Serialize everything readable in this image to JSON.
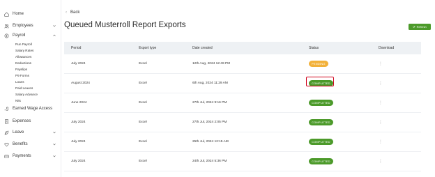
{
  "sidebar": {
    "items": [
      {
        "label": "Home",
        "icon": "home-icon"
      },
      {
        "label": "Employees",
        "icon": "users-icon"
      },
      {
        "label": "Payroll",
        "icon": "money-icon"
      },
      {
        "label": "Earned Wage Access",
        "icon": "hand-coins-icon"
      },
      {
        "label": "Expenses",
        "icon": "receipt-icon"
      },
      {
        "label": "Leave",
        "icon": "leaf-icon"
      },
      {
        "label": "Benefits",
        "icon": "heart-icon"
      },
      {
        "label": "Payments",
        "icon": "card-icon"
      }
    ],
    "payroll_sub": [
      "Run Payroll",
      "Salary Rates",
      "Allowances",
      "Deductions",
      "Payslips",
      "P9 Forms",
      "Loans",
      "Paid Leaves",
      "Salary Advance",
      "Nits"
    ]
  },
  "main": {
    "back_label": "Back",
    "title": "Queued Musterroll Report Exports",
    "refresh_label": "Refresh",
    "columns": [
      "Period",
      "Export type",
      "Date created",
      "Status",
      "Download"
    ],
    "rows": [
      {
        "period": "July 2024",
        "type": "Excel",
        "date": "12th Aug, 2024 12:49 PM",
        "status": "PENDING"
      },
      {
        "period": "August 2024",
        "type": "Excel",
        "date": "6th Aug, 2024 11:29 AM",
        "status": "COMPLETED"
      },
      {
        "period": "June 2024",
        "type": "Excel",
        "date": "27th Jul, 2024 9:16 PM",
        "status": "COMPLETED"
      },
      {
        "period": "July 2024",
        "type": "Excel",
        "date": "27th Jul, 2024 2:05 PM",
        "status": "COMPLETED"
      },
      {
        "period": "July 2024",
        "type": "Excel",
        "date": "25th Jul, 2024 12:15 AM",
        "status": "COMPLETED"
      },
      {
        "period": "July 2024",
        "type": "Excel",
        "date": "24th Jul, 2024 5:36 PM",
        "status": "COMPLETED"
      }
    ],
    "download_icon": "more-vertical-icon"
  },
  "colors": {
    "accent": "#4c9a2a",
    "pending": "#f2b13a",
    "highlight": "#d0021b"
  }
}
